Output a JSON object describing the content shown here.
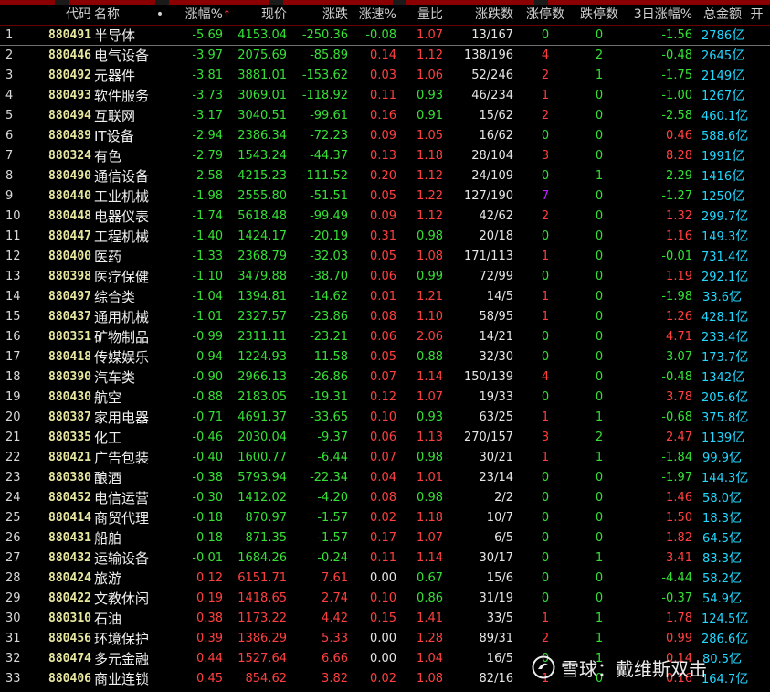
{
  "header": {
    "columns": [
      {
        "key": "idx",
        "label": ""
      },
      {
        "key": "code",
        "label": "代码"
      },
      {
        "key": "name",
        "label": "名称"
      },
      {
        "key": "dot",
        "label": "•"
      },
      {
        "key": "chg",
        "label": "涨幅%"
      },
      {
        "key": "price",
        "label": "现价"
      },
      {
        "key": "diff",
        "label": "涨跌"
      },
      {
        "key": "speed",
        "label": "涨速%"
      },
      {
        "key": "vr",
        "label": "量比"
      },
      {
        "key": "ud",
        "label": "涨跌数"
      },
      {
        "key": "lu",
        "label": "涨停数"
      },
      {
        "key": "ld",
        "label": "跌停数"
      },
      {
        "key": "chg3",
        "label": "3日涨幅%"
      },
      {
        "key": "amt",
        "label": "总金额"
      },
      {
        "key": "more",
        "label": "开"
      }
    ],
    "sort_indicator": "↑"
  },
  "colors": {
    "down": "#36e036",
    "up": "#ff4040",
    "cyan": "#22d8ff",
    "purple": "#c020ff"
  },
  "rows": [
    [
      "1",
      "880491",
      "半导体",
      "-5.69",
      "4153.04",
      "-250.36",
      "-0.08",
      "1.07",
      "13/167",
      "0",
      "0",
      "-1.56",
      "2786",
      "亿"
    ],
    [
      "2",
      "880446",
      "电气设备",
      "-3.97",
      "2075.69",
      "-85.89",
      "0.14",
      "1.12",
      "138/196",
      "4",
      "2",
      "-0.48",
      "2645",
      "亿"
    ],
    [
      "3",
      "880492",
      "元器件",
      "-3.81",
      "3881.01",
      "-153.62",
      "0.03",
      "1.06",
      "52/246",
      "2",
      "1",
      "-1.75",
      "2149",
      "亿"
    ],
    [
      "4",
      "880493",
      "软件服务",
      "-3.73",
      "3069.01",
      "-118.92",
      "0.11",
      "0.93",
      "46/234",
      "1",
      "0",
      "-1.00",
      "1267",
      "亿"
    ],
    [
      "5",
      "880494",
      "互联网",
      "-3.17",
      "3040.51",
      "-99.61",
      "0.16",
      "0.91",
      "15/62",
      "2",
      "0",
      "-2.58",
      "460.1",
      "亿"
    ],
    [
      "6",
      "880489",
      "IT设备",
      "-2.94",
      "2386.34",
      "-72.23",
      "0.09",
      "1.05",
      "16/62",
      "0",
      "0",
      "0.46",
      "588.6",
      "亿"
    ],
    [
      "7",
      "880324",
      "有色",
      "-2.79",
      "1543.24",
      "-44.37",
      "0.13",
      "1.18",
      "28/104",
      "3",
      "0",
      "8.28",
      "1991",
      "亿"
    ],
    [
      "8",
      "880490",
      "通信设备",
      "-2.58",
      "4215.23",
      "-111.52",
      "0.20",
      "1.12",
      "24/109",
      "0",
      "1",
      "-2.29",
      "1416",
      "亿"
    ],
    [
      "9",
      "880440",
      "工业机械",
      "-1.98",
      "2555.80",
      "-51.51",
      "0.05",
      "1.22",
      "127/190",
      "7",
      "0",
      "-1.27",
      "1250",
      "亿"
    ],
    [
      "10",
      "880448",
      "电器仪表",
      "-1.74",
      "5618.48",
      "-99.49",
      "0.09",
      "1.12",
      "42/62",
      "2",
      "0",
      "1.32",
      "299.7",
      "亿"
    ],
    [
      "11",
      "880447",
      "工程机械",
      "-1.40",
      "1424.17",
      "-20.19",
      "0.31",
      "0.98",
      "20/18",
      "0",
      "0",
      "1.16",
      "149.3",
      "亿"
    ],
    [
      "12",
      "880400",
      "医药",
      "-1.33",
      "2368.79",
      "-32.03",
      "0.05",
      "1.08",
      "171/113",
      "1",
      "0",
      "-0.01",
      "731.4",
      "亿"
    ],
    [
      "13",
      "880398",
      "医疗保健",
      "-1.10",
      "3479.88",
      "-38.70",
      "0.06",
      "0.99",
      "72/99",
      "0",
      "0",
      "1.19",
      "292.1",
      "亿"
    ],
    [
      "14",
      "880497",
      "综合类",
      "-1.04",
      "1394.81",
      "-14.62",
      "0.01",
      "1.21",
      "14/5",
      "1",
      "0",
      "-1.98",
      "33.6",
      "亿"
    ],
    [
      "15",
      "880437",
      "通用机械",
      "-1.01",
      "2327.57",
      "-23.86",
      "0.08",
      "1.10",
      "58/95",
      "1",
      "0",
      "1.26",
      "428.1",
      "亿"
    ],
    [
      "16",
      "880351",
      "矿物制品",
      "-0.99",
      "2311.11",
      "-23.21",
      "0.06",
      "2.06",
      "14/21",
      "0",
      "0",
      "4.71",
      "233.4",
      "亿"
    ],
    [
      "17",
      "880418",
      "传媒娱乐",
      "-0.94",
      "1224.93",
      "-11.58",
      "0.05",
      "0.88",
      "32/30",
      "0",
      "0",
      "-3.07",
      "173.7",
      "亿"
    ],
    [
      "18",
      "880390",
      "汽车类",
      "-0.90",
      "2966.13",
      "-26.86",
      "0.07",
      "1.14",
      "150/139",
      "4",
      "0",
      "-0.48",
      "1342",
      "亿"
    ],
    [
      "19",
      "880430",
      "航空",
      "-0.88",
      "2183.05",
      "-19.31",
      "0.12",
      "1.07",
      "19/33",
      "0",
      "0",
      "3.78",
      "205.6",
      "亿"
    ],
    [
      "20",
      "880387",
      "家用电器",
      "-0.71",
      "4691.37",
      "-33.65",
      "0.10",
      "0.93",
      "63/25",
      "1",
      "1",
      "-0.68",
      "375.8",
      "亿"
    ],
    [
      "21",
      "880335",
      "化工",
      "-0.46",
      "2030.04",
      "-9.37",
      "0.06",
      "1.13",
      "270/157",
      "3",
      "2",
      "2.47",
      "1139",
      "亿"
    ],
    [
      "22",
      "880421",
      "广告包装",
      "-0.40",
      "1600.77",
      "-6.44",
      "0.07",
      "0.98",
      "30/21",
      "1",
      "1",
      "-1.84",
      "99.9",
      "亿"
    ],
    [
      "23",
      "880380",
      "酿酒",
      "-0.38",
      "5793.94",
      "-22.34",
      "0.04",
      "1.01",
      "23/14",
      "0",
      "0",
      "-1.97",
      "144.3",
      "亿"
    ],
    [
      "24",
      "880452",
      "电信运营",
      "-0.30",
      "1412.02",
      "-4.20",
      "0.08",
      "0.98",
      "2/2",
      "0",
      "0",
      "1.46",
      "58.0",
      "亿"
    ],
    [
      "25",
      "880414",
      "商贸代理",
      "-0.18",
      "870.97",
      "-1.57",
      "0.02",
      "1.18",
      "10/7",
      "0",
      "0",
      "1.50",
      "18.3",
      "亿"
    ],
    [
      "26",
      "880431",
      "船舶",
      "-0.18",
      "871.35",
      "-1.57",
      "0.17",
      "1.07",
      "6/5",
      "0",
      "0",
      "1.82",
      "64.5",
      "亿"
    ],
    [
      "27",
      "880432",
      "运输设备",
      "-0.01",
      "1684.26",
      "-0.24",
      "0.11",
      "1.14",
      "30/17",
      "0",
      "1",
      "3.41",
      "83.3",
      "亿"
    ],
    [
      "28",
      "880424",
      "旅游",
      "0.12",
      "6151.71",
      "7.61",
      "0.00",
      "0.67",
      "15/6",
      "0",
      "0",
      "-4.44",
      "58.2",
      "亿"
    ],
    [
      "29",
      "880422",
      "文教休闲",
      "0.19",
      "1418.65",
      "2.74",
      "0.10",
      "0.86",
      "31/19",
      "0",
      "0",
      "-0.37",
      "54.9",
      "亿"
    ],
    [
      "30",
      "880310",
      "石油",
      "0.38",
      "1173.22",
      "4.42",
      "0.15",
      "1.41",
      "33/5",
      "1",
      "1",
      "1.78",
      "124.5",
      "亿"
    ],
    [
      "31",
      "880456",
      "环境保护",
      "0.39",
      "1386.29",
      "5.33",
      "0.00",
      "1.28",
      "89/31",
      "2",
      "1",
      "0.99",
      "286.6",
      "亿"
    ],
    [
      "32",
      "880474",
      "多元金融",
      "0.44",
      "1527.64",
      "6.66",
      "0.00",
      "1.04",
      "16/5",
      "0",
      "1",
      "0.14",
      "80.5",
      "亿"
    ],
    [
      "33",
      "880406",
      "商业连锁",
      "0.45",
      "854.62",
      "3.82",
      "0.02",
      "1.08",
      "82/16",
      "1",
      "0",
      "0.16",
      "164.7",
      "亿"
    ]
  ],
  "watermark": {
    "text": "雪球：戴维斯双击",
    "icon": "snowball-logo-icon"
  }
}
